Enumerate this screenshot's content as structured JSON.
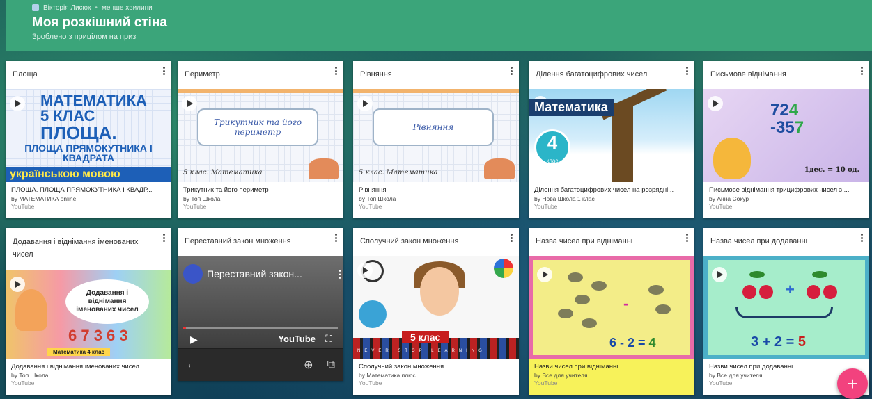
{
  "header": {
    "author": "Вікторія Лисюк",
    "time": "менше хвилини",
    "title": "Моя розкішний стіна",
    "subtitle": "Зроблено з прицілом на приз"
  },
  "cards": [
    {
      "heading": "Площа",
      "thumb": {
        "l1": "МАТЕМАТИКА",
        "l2": "5 КЛАС",
        "l3": "ПЛОЩА.",
        "l4": "ПЛОЩА ПРЯМОКУТНИКА І КВАДРАТА",
        "l5": "українською мовою"
      },
      "title": "ПЛОЩА. ПЛОЩА ПРЯМОКУТНИКА І КВАДР...",
      "by": "by МАТЕМАТИКА online",
      "source": "YouTube"
    },
    {
      "heading": "Периметр",
      "thumb": {
        "box": "Трикутник та його периметр",
        "foot": "5 клас. Математика"
      },
      "title": "Трикутник та його периметр",
      "by": "by Топ Школа",
      "source": "YouTube"
    },
    {
      "heading": "Рівняння",
      "thumb": {
        "box": "Рівняння",
        "foot": "5 клас. Математика"
      },
      "title": "Рівняння",
      "by": "by Топ Школа",
      "source": "YouTube"
    },
    {
      "heading": "Ділення багатоцифрових чисел",
      "thumb": {
        "label": "Математика",
        "num": "4",
        "cls": "клас"
      },
      "title": "Ділення багатоцифрових чисел на розрядні...",
      "by": "by Нова Школа 1 клас",
      "source": "YouTube"
    },
    {
      "heading": "Письмове віднімання",
      "thumb": {
        "top": "72",
        "topg": "4",
        "bot": "-35",
        "botg": "7",
        "eq": "1дес. = 10 од.",
        "ten": "10"
      },
      "title": "Письмове віднімання трицифрових чисел з ...",
      "by": "by Анна Сокур",
      "source": "YouTube"
    },
    {
      "heading": "Додавання і віднімання іменованих чисел",
      "thumb": {
        "cloud": "Додавання і віднімання іменованих чисел",
        "nums": "6 7 3 6 3",
        "bar": "Математика   4 клас"
      },
      "title": "Додавання і віднімання іменованих чисел",
      "by": "by Топ Школа",
      "source": "YouTube"
    },
    {
      "heading": "Переставний закон множення",
      "player": {
        "video_title": "Переставний закон...",
        "brand": "YouTube"
      }
    },
    {
      "heading": "Сполучний закон множення",
      "thumb": {
        "grade": "5 клас",
        "slogan": "NEVER STOP LEARNING"
      },
      "title": "Сполучний закон множення",
      "by": "by Математика плюс",
      "source": "YouTube"
    },
    {
      "heading": "Назва чисел при відніманні",
      "thumb": {
        "minus": "-",
        "eq_a": "6 - 2 = ",
        "eq_b": "4"
      },
      "title": "Назви чисел при відніманні",
      "by": "by Все для учителя",
      "source": "YouTube"
    },
    {
      "heading": "Назва чисел при додаванні",
      "thumb": {
        "plus": "+",
        "eq_a": "3 + 2 = ",
        "eq_b": "5"
      },
      "title": "Назви чисел при додаванні",
      "by": "by Все для учителя",
      "source": "YouTube"
    }
  ],
  "fab": {
    "label": "+"
  }
}
